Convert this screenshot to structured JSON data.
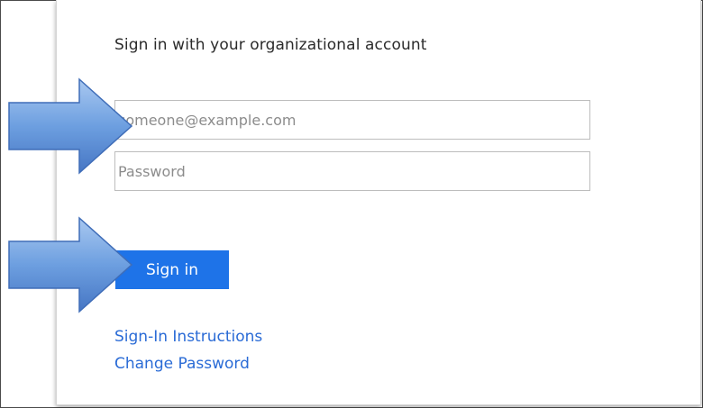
{
  "login": {
    "heading": "Sign in with your organizational account",
    "email_placeholder": "someone@example.com",
    "password_placeholder": "Password",
    "signin_label": "Sign in",
    "links": {
      "instructions": "Sign-In Instructions",
      "change_password": "Change Password"
    }
  },
  "annotations": {
    "arrow_icon": "right-arrow-icon",
    "arrow_color": "#5b8fd6"
  },
  "colors": {
    "button": "#1e73e8",
    "link": "#2a6bd6",
    "text": "#2b2b2b"
  }
}
